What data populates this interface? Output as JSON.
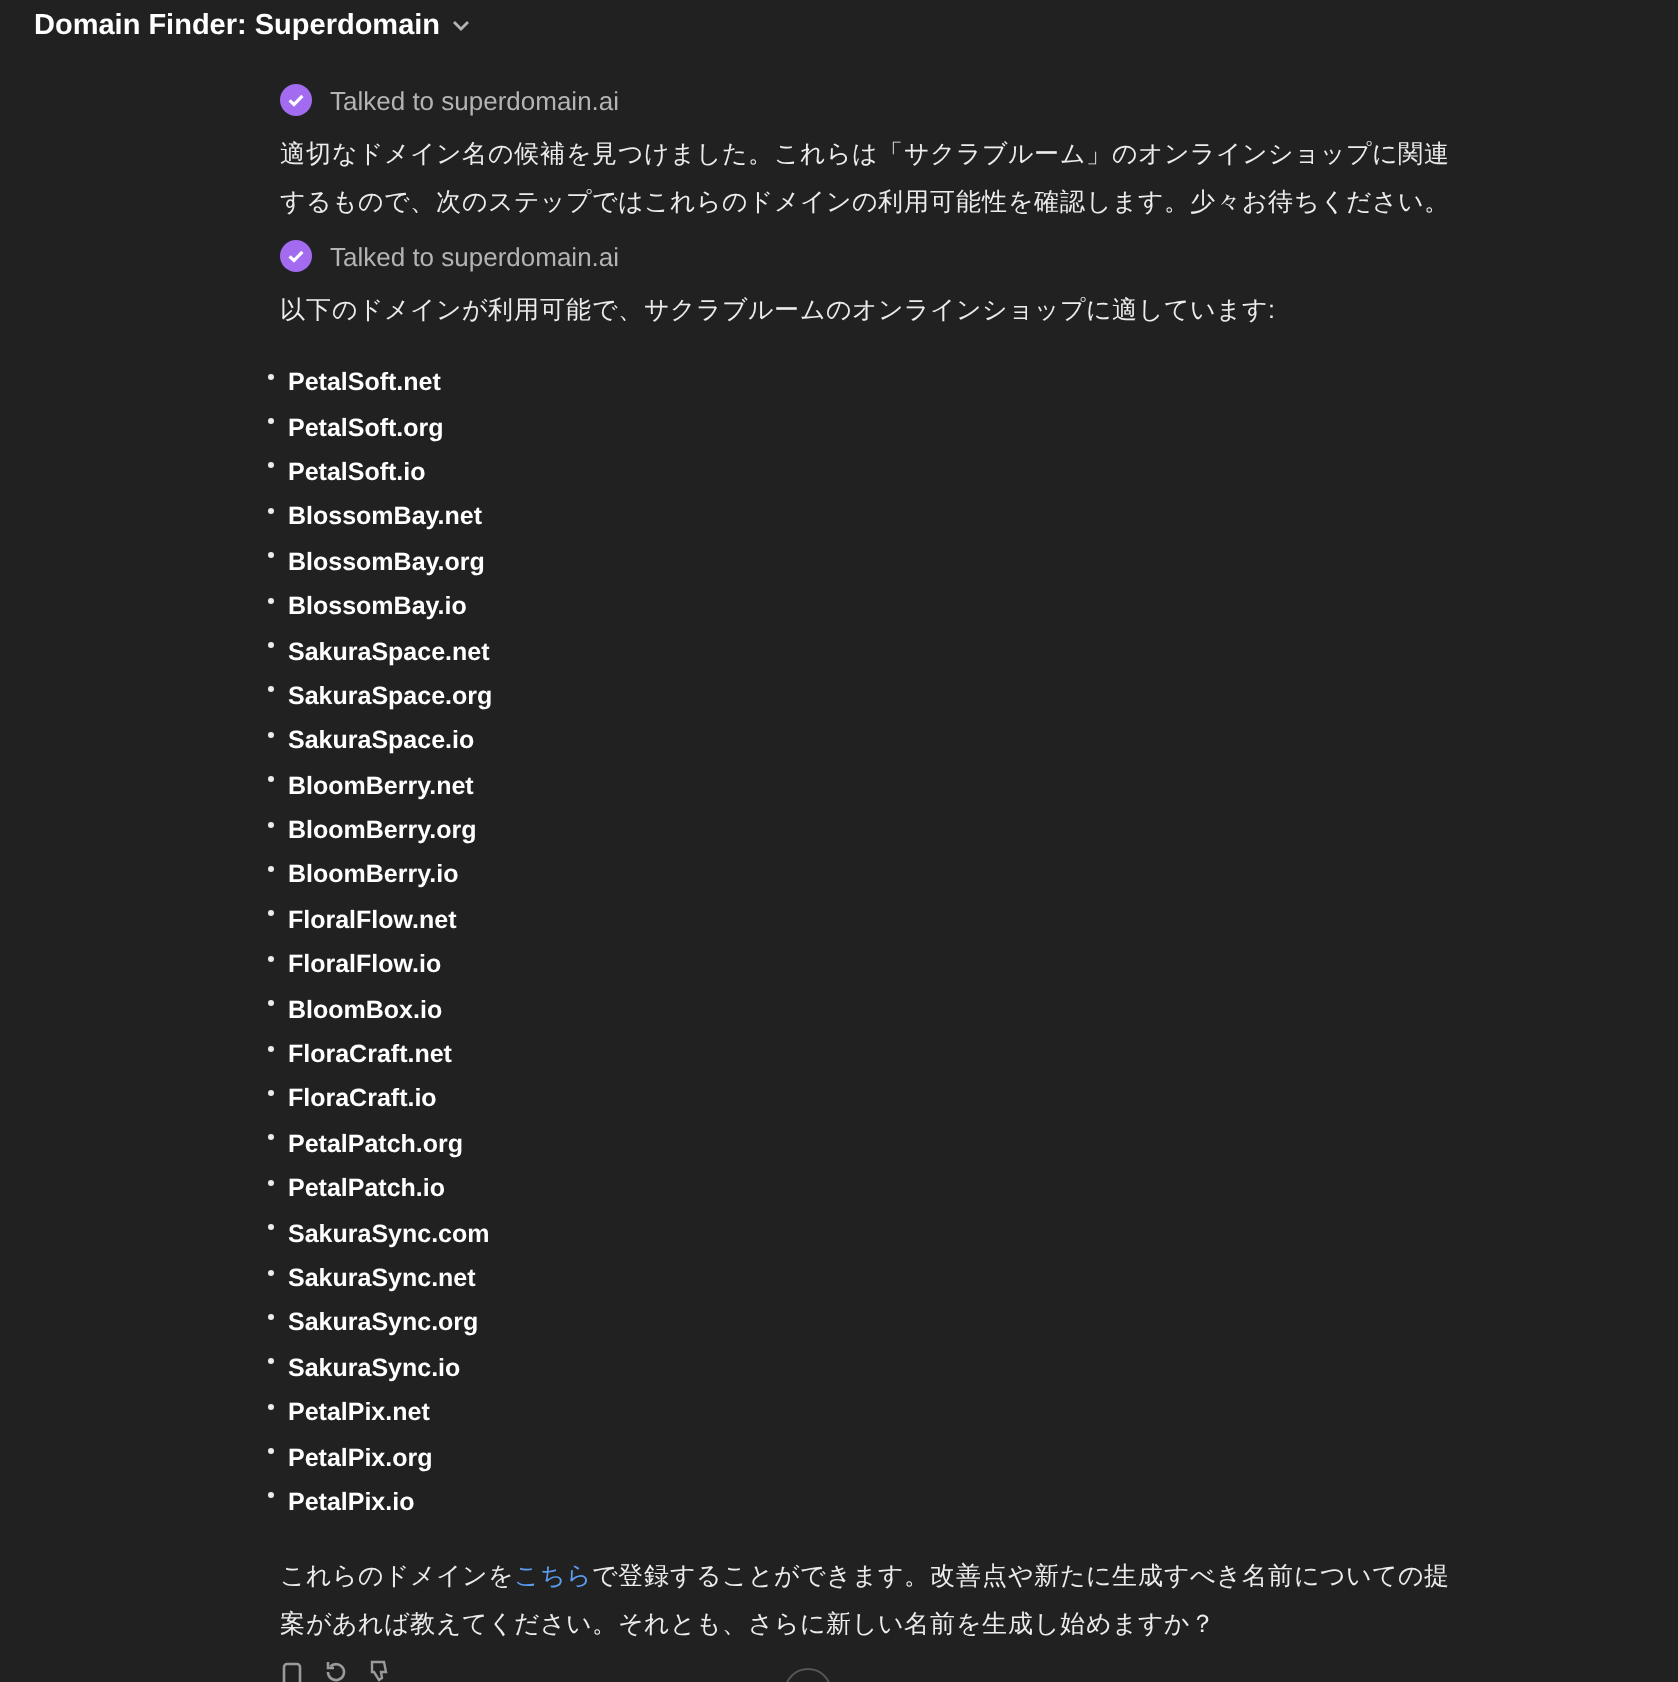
{
  "header": {
    "title": "Domain Finder: Superdomain"
  },
  "messages": [
    {
      "kind": "tool",
      "label": "Talked to superdomain.ai"
    },
    {
      "kind": "text",
      "lines": [
        "適切なドメイン名の候補を見つけました。これらは「サクラブルーム」のオンラインショップに関連",
        "するもので、次のステップではこれらのドメインの利用可能性を確認します。少々お待ちください。"
      ]
    },
    {
      "kind": "tool",
      "label": "Talked to superdomain.ai"
    },
    {
      "kind": "text",
      "lines": [
        "以下のドメインが利用可能で、サクラブルームのオンラインショップに適しています:"
      ]
    }
  ],
  "domains": [
    "PetalSoft.net",
    "PetalSoft.org",
    "PetalSoft.io",
    "BlossomBay.net",
    "BlossomBay.org",
    "BlossomBay.io",
    "SakuraSpace.net",
    "SakuraSpace.org",
    "SakuraSpace.io",
    "BloomBerry.net",
    "BloomBerry.org",
    "BloomBerry.io",
    "FloralFlow.net",
    "FloralFlow.io",
    "BloomBox.io",
    "FloraCraft.net",
    "FloraCraft.io",
    "PetalPatch.org",
    "PetalPatch.io",
    "SakuraSync.com",
    "SakuraSync.net",
    "SakuraSync.org",
    "SakuraSync.io",
    "PetalPix.net",
    "PetalPix.org",
    "PetalPix.io"
  ],
  "closing": {
    "before": "これらのドメインを",
    "link": "こちら",
    "after": "で登録することができます。改善点や新たに生成すべき名前についての提",
    "line2": "案があれば教えてください。それとも、さらに新しい名前を生成し始めますか？"
  }
}
